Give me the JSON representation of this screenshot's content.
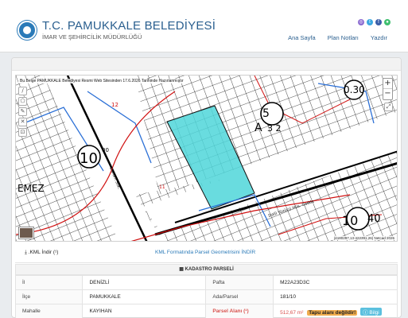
{
  "header": {
    "title": "T.C. PAMUKKALE BELEDİYESİ",
    "subtitle": "İMAR VE ŞEHİRCİLİK MÜDÜRLÜĞÜ",
    "nav": [
      "Ana Sayfa",
      "Plan Notları",
      "Yazdır"
    ],
    "social_icons": [
      "instagram-icon",
      "twitter-icon",
      "facebook-icon",
      "user-icon"
    ]
  },
  "map": {
    "note": "Bu Belge PAMUKKALE Belediyesi Resmi Web Sitesinden 17.6.2026 Tarihinde Hazırlanmıştır",
    "attribution": "(4180297,13-422391,26) Netcad 2026",
    "zoom_in": "+",
    "zoom_out": "−",
    "labels": {
      "parcel_12": "12",
      "parcel_11": "11",
      "block_10": "10",
      "block_10_sup": "00",
      "block_5": "5",
      "block_a": "A",
      "block_32": "3 2",
      "block_10b": "10",
      "block_40": "40",
      "code_0_30": "0.30",
      "road_emez": "EMEZ",
      "road_main": "Dalil Yüzücü Hüs. Cadde",
      "road_side": "Durum Sok."
    },
    "colors": {
      "highlight": "#4fd6d9",
      "road": "#000000",
      "contour": "#d01010",
      "grid": "#1a1a1a",
      "blue": "#2a6fd6"
    }
  },
  "tabs": {
    "kml_download": ".KML İndir (¹)",
    "kml_format": "KML Formatında Parsel Geometrisini İNDİR"
  },
  "kadastro": {
    "title": "KADASTRO PARSELİ",
    "rows": [
      {
        "l1": "İl",
        "v1": "DENİZLİ",
        "l2": "Pafta",
        "v2": "M22A23D3C"
      },
      {
        "l1": "İlçe",
        "v1": "PAMUKKALE",
        "l2": "Ada/Parsel",
        "v2": "181/10"
      },
      {
        "l1": "Mahalle",
        "v1": "KAYIHAN",
        "l2": "Parsel Alanı (¹)",
        "v2": "512,67 m²"
      }
    ],
    "area_warning": "Tapu alanı değildir!",
    "info_label": "Bilgi"
  }
}
